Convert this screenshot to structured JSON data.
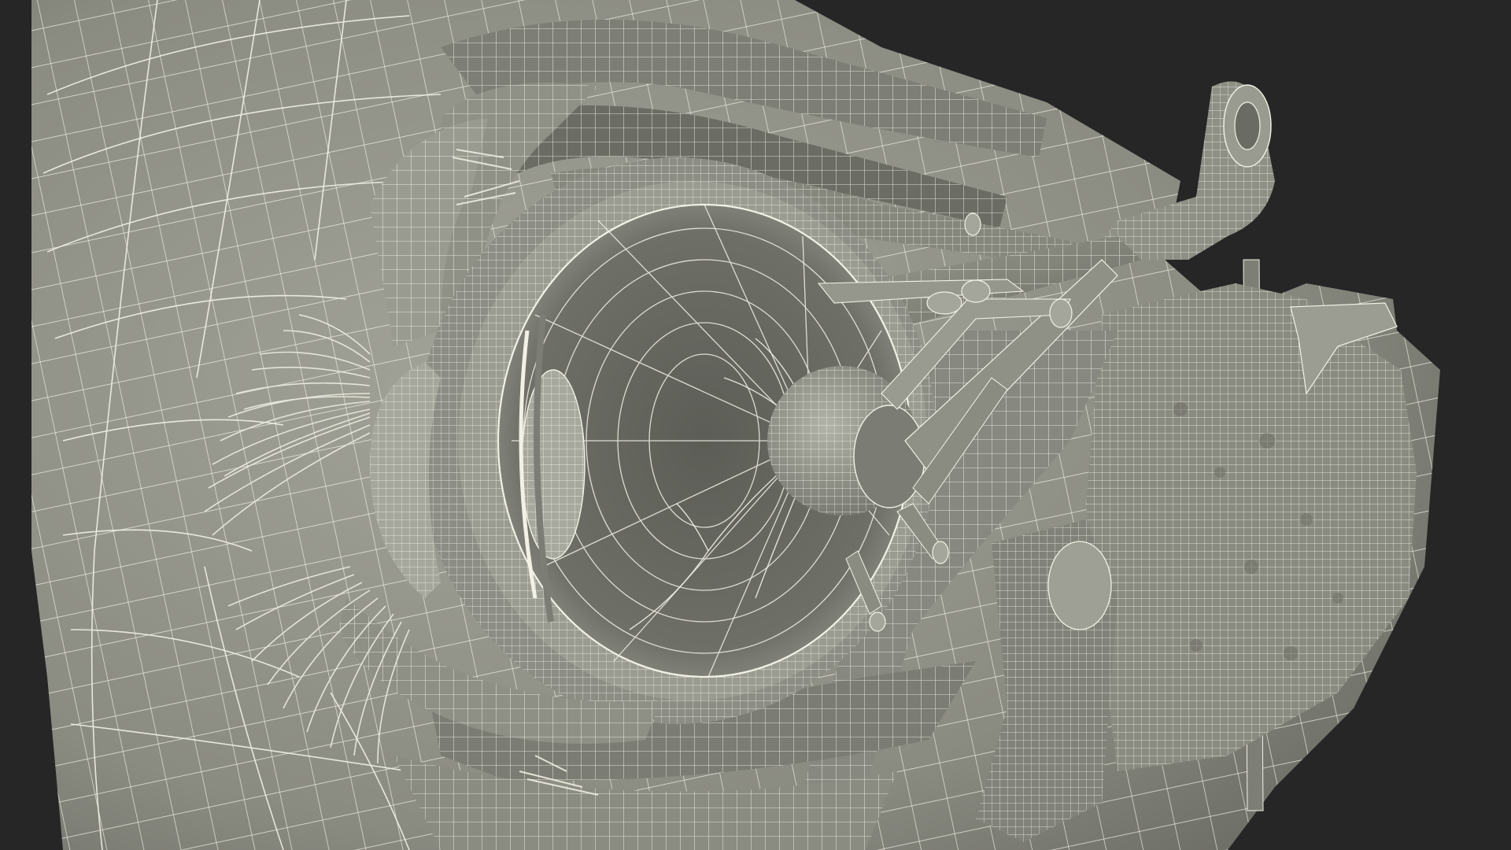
{
  "scene": {
    "subject": "",
    "colors": {
      "background": "#262626",
      "model_fill": "#8c8d83",
      "model_shadow": "#5f6058",
      "model_highlight": "#a9aa9f",
      "wireframe": "#f2f1e6"
    }
  }
}
